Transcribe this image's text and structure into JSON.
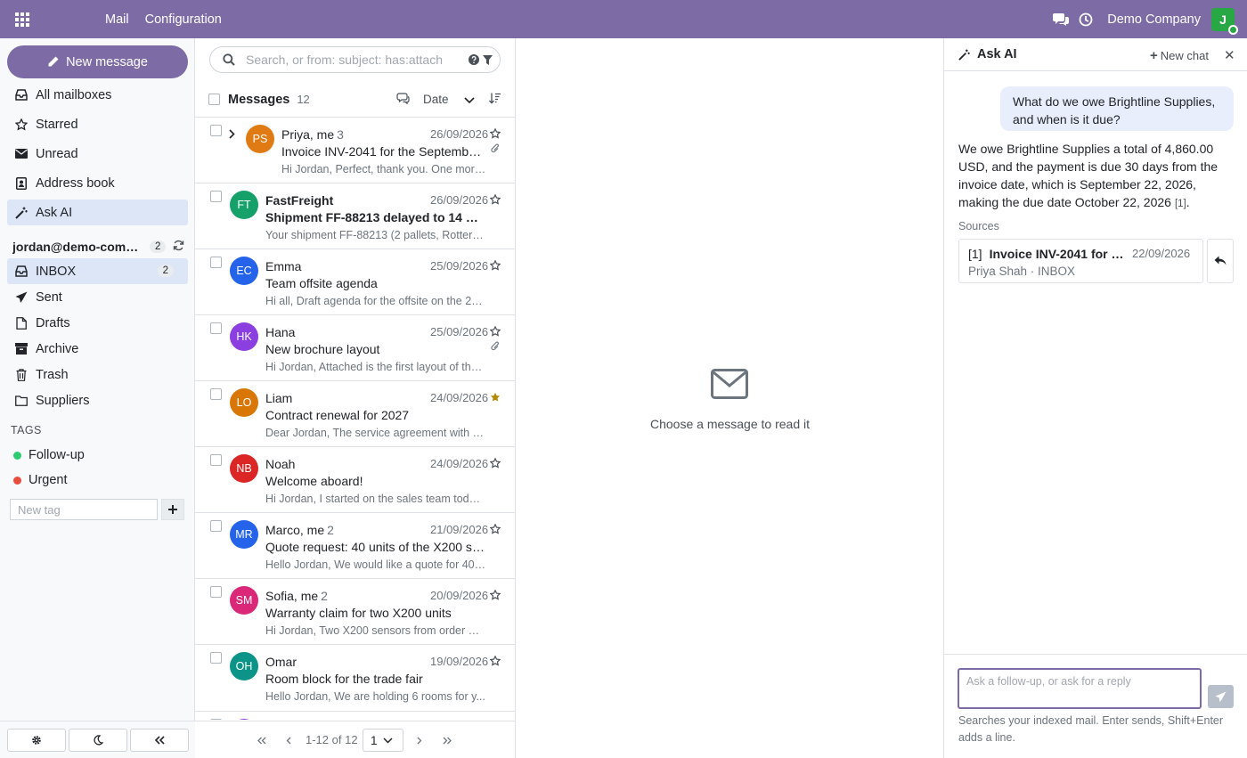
{
  "topbar": {
    "brand": "Mail",
    "menu": "Configuration",
    "company": "Demo Company",
    "user_initial": "J",
    "accent": "#7c6ba5"
  },
  "sidebar": {
    "new_message": "New message",
    "items": [
      {
        "label": "All mailboxes",
        "icon": "inbox-icon"
      },
      {
        "label": "Starred",
        "icon": "star-icon"
      },
      {
        "label": "Unread",
        "icon": "envelope-icon"
      },
      {
        "label": "Address book",
        "icon": "contact-book-icon"
      },
      {
        "label": "Ask AI",
        "icon": "magic-wand-icon"
      }
    ],
    "account": {
      "label": "jordan@demo-compa...",
      "badge": "2"
    },
    "folders": [
      {
        "label": "INBOX",
        "icon": "inbox-icon",
        "badge": "2"
      },
      {
        "label": "Sent",
        "icon": "paper-plane-icon"
      },
      {
        "label": "Drafts",
        "icon": "file-icon"
      },
      {
        "label": "Archive",
        "icon": "archive-box-icon"
      },
      {
        "label": "Trash",
        "icon": "trash-icon"
      },
      {
        "label": "Suppliers",
        "icon": "folder-icon"
      }
    ],
    "tags_title": "TAGS",
    "tags": [
      {
        "label": "Follow-up",
        "color": "#2ecc71"
      },
      {
        "label": "Urgent",
        "color": "#e74c3c"
      }
    ],
    "new_tag_placeholder": "New tag"
  },
  "list": {
    "search_placeholder": "Search, or from: subject: has:attachm",
    "title": "Messages",
    "count": "12",
    "sort_label": "Date",
    "rows": [
      {
        "sender": "Priya, me",
        "count": "3",
        "initials": "PS",
        "color": "#e07b14",
        "date": "26/09/2026",
        "subject": "Invoice INV-2041 for the September ...",
        "preview": "Hi Jordan, Perfect, thank you. One more ...",
        "unread": false,
        "starred": false,
        "attachment": true,
        "thread": true
      },
      {
        "sender": "FastFreight",
        "count": "",
        "initials": "FT",
        "color": "#16a06a",
        "date": "26/09/2026",
        "subject": "Shipment FF-88213 delayed to 14 Octo...",
        "preview": "Your shipment FF-88213 (2 pallets, Rotterda...",
        "unread": true,
        "starred": false,
        "attachment": false,
        "thread": false
      },
      {
        "sender": "Emma",
        "count": "",
        "initials": "EC",
        "color": "#2563eb",
        "date": "25/09/2026",
        "subject": "Team offsite agenda",
        "preview": "Hi all, Draft agenda for the offsite on the 24...",
        "unread": false,
        "starred": false,
        "attachment": false,
        "thread": false
      },
      {
        "sender": "Hana",
        "count": "",
        "initials": "HK",
        "color": "#8b3fe0",
        "date": "25/09/2026",
        "subject": "New brochure layout",
        "preview": "Hi Jordan, Attached is the first layout of the ...",
        "unread": false,
        "starred": false,
        "attachment": true,
        "thread": false
      },
      {
        "sender": "Liam",
        "count": "",
        "initials": "LO",
        "color": "#d97706",
        "date": "24/09/2026",
        "subject": "Contract renewal for 2027",
        "preview": "Dear Jordan, The service agreement with Lu...",
        "unread": false,
        "starred": true,
        "attachment": false,
        "thread": false
      },
      {
        "sender": "Noah",
        "count": "",
        "initials": "NB",
        "color": "#dc2626",
        "date": "24/09/2026",
        "subject": "Welcome aboard!",
        "preview": "Hi Jordan, I started on the sales team today....",
        "unread": false,
        "starred": false,
        "attachment": false,
        "thread": false
      },
      {
        "sender": "Marco, me",
        "count": "2",
        "initials": "MR",
        "color": "#2563eb",
        "date": "21/09/2026",
        "subject": "Quote request: 40 units of the X200 sens...",
        "preview": "Hello Jordan, We would like a quote for 40 ...",
        "unread": false,
        "starred": false,
        "attachment": false,
        "thread": false
      },
      {
        "sender": "Sofia, me",
        "count": "2",
        "initials": "SM",
        "color": "#db2777",
        "date": "20/09/2026",
        "subject": "Warranty claim for two X200 units",
        "preview": "Hi Jordan, Two X200 sensors from order SO...",
        "unread": false,
        "starred": false,
        "attachment": false,
        "thread": false
      },
      {
        "sender": "Omar",
        "count": "",
        "initials": "OH",
        "color": "#0d9488",
        "date": "19/09/2026",
        "subject": "Room block for the trade fair",
        "preview": "Hello Jordan, We are holding 6 rooms for y...",
        "unread": false,
        "starred": false,
        "attachment": false,
        "thread": false
      }
    ],
    "pager": {
      "range": "1-12 of 12",
      "page": "1"
    }
  },
  "reader": {
    "empty_text": "Choose a message to read it"
  },
  "ai": {
    "title": "Ask AI",
    "new_chat": "New chat",
    "question_line1": "What do we owe Brightline Supplies,",
    "question_line2": "and when is it due?",
    "answer": "We owe Brightline Supplies a total of 4,860.00 USD, and the payment is due 30 days from the invoice date, which is September 22, 2026, making the due date October 22, 2026",
    "answer_cite": "[1]",
    "answer_end": ".",
    "sources_label": "Sources",
    "source": {
      "index": "[1]",
      "title": "Invoice INV-2041 for th...",
      "date": "22/09/2026",
      "subtitle": "Priya Shah · INBOX"
    },
    "input_placeholder": "Ask a follow-up, or ask for a reply",
    "hint": "Searches your indexed mail. Enter sends, Shift+Enter adds a line."
  }
}
